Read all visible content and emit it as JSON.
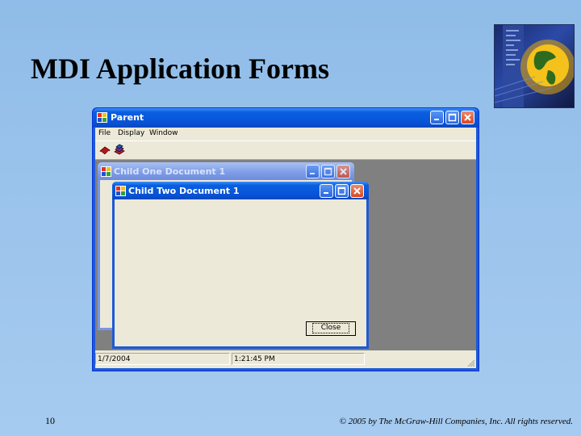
{
  "slide": {
    "title": "MDI Application Forms",
    "number": "10",
    "copyright": "© 2005 by The McGraw-Hill Companies, Inc. All rights reserved."
  },
  "parent": {
    "title": "Parent",
    "menu": [
      "File",
      "Display",
      "Window"
    ],
    "toolbar": [
      {
        "icon": "red-book-icon"
      },
      {
        "icon": "stacked-books-icon"
      }
    ],
    "status": {
      "date": "1/7/2004",
      "time": "1:21:45 PM"
    }
  },
  "child_one": {
    "title": "Child One Document 1"
  },
  "child_two": {
    "title": "Child Two Document 1",
    "close_label": "Close"
  },
  "colors": {
    "slide_background": "#9cc4ec",
    "active_titlebar": "#0854d8",
    "inactive_titlebar": "#7d9be6",
    "window_body": "#ece9d8",
    "mdi_client": "#808080"
  }
}
